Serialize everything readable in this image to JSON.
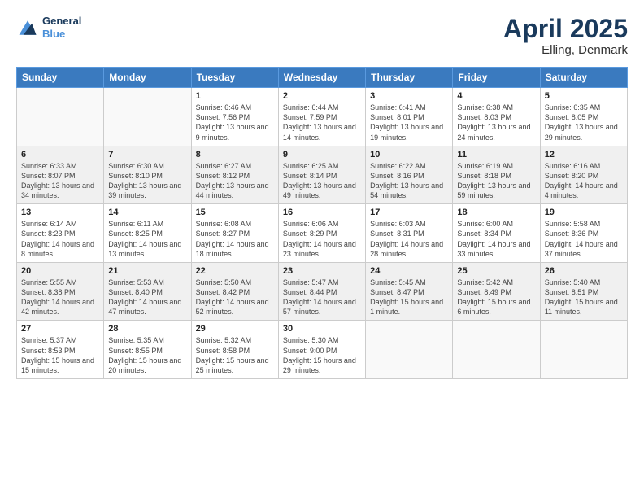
{
  "logo": {
    "line1": "General",
    "line2": "Blue"
  },
  "title": {
    "month_year": "April 2025",
    "location": "Elling, Denmark"
  },
  "weekdays": [
    "Sunday",
    "Monday",
    "Tuesday",
    "Wednesday",
    "Thursday",
    "Friday",
    "Saturday"
  ],
  "weeks": [
    [
      {
        "day": "",
        "info": ""
      },
      {
        "day": "",
        "info": ""
      },
      {
        "day": "1",
        "info": "Sunrise: 6:46 AM\nSunset: 7:56 PM\nDaylight: 13 hours and 9 minutes."
      },
      {
        "day": "2",
        "info": "Sunrise: 6:44 AM\nSunset: 7:59 PM\nDaylight: 13 hours and 14 minutes."
      },
      {
        "day": "3",
        "info": "Sunrise: 6:41 AM\nSunset: 8:01 PM\nDaylight: 13 hours and 19 minutes."
      },
      {
        "day": "4",
        "info": "Sunrise: 6:38 AM\nSunset: 8:03 PM\nDaylight: 13 hours and 24 minutes."
      },
      {
        "day": "5",
        "info": "Sunrise: 6:35 AM\nSunset: 8:05 PM\nDaylight: 13 hours and 29 minutes."
      }
    ],
    [
      {
        "day": "6",
        "info": "Sunrise: 6:33 AM\nSunset: 8:07 PM\nDaylight: 13 hours and 34 minutes."
      },
      {
        "day": "7",
        "info": "Sunrise: 6:30 AM\nSunset: 8:10 PM\nDaylight: 13 hours and 39 minutes."
      },
      {
        "day": "8",
        "info": "Sunrise: 6:27 AM\nSunset: 8:12 PM\nDaylight: 13 hours and 44 minutes."
      },
      {
        "day": "9",
        "info": "Sunrise: 6:25 AM\nSunset: 8:14 PM\nDaylight: 13 hours and 49 minutes."
      },
      {
        "day": "10",
        "info": "Sunrise: 6:22 AM\nSunset: 8:16 PM\nDaylight: 13 hours and 54 minutes."
      },
      {
        "day": "11",
        "info": "Sunrise: 6:19 AM\nSunset: 8:18 PM\nDaylight: 13 hours and 59 minutes."
      },
      {
        "day": "12",
        "info": "Sunrise: 6:16 AM\nSunset: 8:20 PM\nDaylight: 14 hours and 4 minutes."
      }
    ],
    [
      {
        "day": "13",
        "info": "Sunrise: 6:14 AM\nSunset: 8:23 PM\nDaylight: 14 hours and 8 minutes."
      },
      {
        "day": "14",
        "info": "Sunrise: 6:11 AM\nSunset: 8:25 PM\nDaylight: 14 hours and 13 minutes."
      },
      {
        "day": "15",
        "info": "Sunrise: 6:08 AM\nSunset: 8:27 PM\nDaylight: 14 hours and 18 minutes."
      },
      {
        "day": "16",
        "info": "Sunrise: 6:06 AM\nSunset: 8:29 PM\nDaylight: 14 hours and 23 minutes."
      },
      {
        "day": "17",
        "info": "Sunrise: 6:03 AM\nSunset: 8:31 PM\nDaylight: 14 hours and 28 minutes."
      },
      {
        "day": "18",
        "info": "Sunrise: 6:00 AM\nSunset: 8:34 PM\nDaylight: 14 hours and 33 minutes."
      },
      {
        "day": "19",
        "info": "Sunrise: 5:58 AM\nSunset: 8:36 PM\nDaylight: 14 hours and 37 minutes."
      }
    ],
    [
      {
        "day": "20",
        "info": "Sunrise: 5:55 AM\nSunset: 8:38 PM\nDaylight: 14 hours and 42 minutes."
      },
      {
        "day": "21",
        "info": "Sunrise: 5:53 AM\nSunset: 8:40 PM\nDaylight: 14 hours and 47 minutes."
      },
      {
        "day": "22",
        "info": "Sunrise: 5:50 AM\nSunset: 8:42 PM\nDaylight: 14 hours and 52 minutes."
      },
      {
        "day": "23",
        "info": "Sunrise: 5:47 AM\nSunset: 8:44 PM\nDaylight: 14 hours and 57 minutes."
      },
      {
        "day": "24",
        "info": "Sunrise: 5:45 AM\nSunset: 8:47 PM\nDaylight: 15 hours and 1 minute."
      },
      {
        "day": "25",
        "info": "Sunrise: 5:42 AM\nSunset: 8:49 PM\nDaylight: 15 hours and 6 minutes."
      },
      {
        "day": "26",
        "info": "Sunrise: 5:40 AM\nSunset: 8:51 PM\nDaylight: 15 hours and 11 minutes."
      }
    ],
    [
      {
        "day": "27",
        "info": "Sunrise: 5:37 AM\nSunset: 8:53 PM\nDaylight: 15 hours and 15 minutes."
      },
      {
        "day": "28",
        "info": "Sunrise: 5:35 AM\nSunset: 8:55 PM\nDaylight: 15 hours and 20 minutes."
      },
      {
        "day": "29",
        "info": "Sunrise: 5:32 AM\nSunset: 8:58 PM\nDaylight: 15 hours and 25 minutes."
      },
      {
        "day": "30",
        "info": "Sunrise: 5:30 AM\nSunset: 9:00 PM\nDaylight: 15 hours and 29 minutes."
      },
      {
        "day": "",
        "info": ""
      },
      {
        "day": "",
        "info": ""
      },
      {
        "day": "",
        "info": ""
      }
    ]
  ]
}
